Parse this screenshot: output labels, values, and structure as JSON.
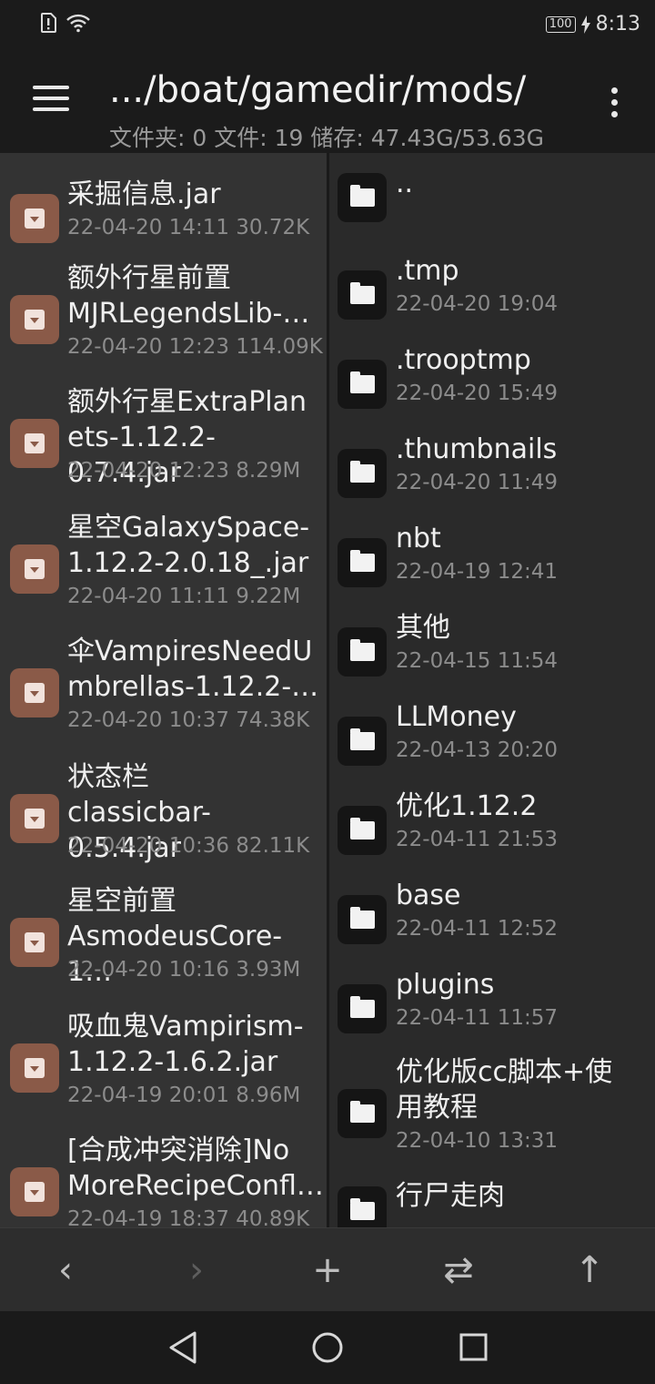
{
  "status_bar": {
    "battery": "100",
    "time": "8:13",
    "icons": [
      "sim-alert-icon",
      "wifi-icon",
      "battery-icon",
      "charging-icon"
    ]
  },
  "toolbar": {
    "path": ".../boat/gamedir/mods/",
    "summary": "文件夹: 0  文件: 19  储存: 47.43G/53.63G",
    "menu_icon": "hamburger-menu-icon",
    "more_icon": "more-vertical-icon"
  },
  "left_pane": {
    "files": [
      {
        "name": "采掘信息.jar",
        "meta": "22-04-20 14:11  30.72K"
      },
      {
        "name": "额外行星前置\nMJRLegendsLib-…",
        "meta": "22-04-20 12:23  114.09K"
      },
      {
        "name": "额外行星ExtraPlan\nets-1.12.2-0.7.4.jar",
        "meta": "22-04-20 12:23  8.29M"
      },
      {
        "name": "星空GalaxySpace-\n1.12.2-2.0.18_.jar",
        "meta": "22-04-20 11:11  9.22M"
      },
      {
        "name": "伞VampiresNeedU\nmbrellas-1.12.2-…",
        "meta": "22-04-20 10:37  74.38K"
      },
      {
        "name": "状态栏\nclassicbar-0.5.4.jar",
        "meta": "22-04-20 10:36  82.11K"
      },
      {
        "name": "星空前置\nAsmodeusCore-1…",
        "meta": "22-04-20 10:16  3.93M"
      },
      {
        "name": "吸血鬼Vampirism-\n1.12.2-1.6.2.jar",
        "meta": "22-04-19 20:01  8.96M"
      },
      {
        "name": "[合成冲突消除]No\nMoreRecipeConfl…",
        "meta": "22-04-19 18:37  40.89K"
      }
    ]
  },
  "right_pane": {
    "dirs": [
      {
        "name": "..",
        "meta": ""
      },
      {
        "name": ".tmp",
        "meta": "22-04-20 19:04"
      },
      {
        "name": ".trooptmp",
        "meta": "22-04-20 15:49"
      },
      {
        "name": ".thumbnails",
        "meta": "22-04-20 11:49"
      },
      {
        "name": "nbt",
        "meta": "22-04-19 12:41"
      },
      {
        "name": "其他",
        "meta": "22-04-15 11:54"
      },
      {
        "name": "LLMoney",
        "meta": "22-04-13 20:20"
      },
      {
        "name": "优化1.12.2",
        "meta": "22-04-11 21:53"
      },
      {
        "name": "base",
        "meta": "22-04-11 12:52"
      },
      {
        "name": "plugins",
        "meta": "22-04-11 11:57"
      },
      {
        "name": "优化版cc脚本+使\n用教程",
        "meta": "22-04-10 13:31"
      },
      {
        "name": "行尸走肉",
        "meta": ""
      }
    ]
  },
  "action_bar": {
    "back": "‹",
    "forward": "›",
    "add": "+",
    "swap": "⇄",
    "up": "↑"
  },
  "nav_bar": {
    "icons": [
      "nav-back-icon",
      "nav-home-icon",
      "nav-recents-icon"
    ]
  }
}
